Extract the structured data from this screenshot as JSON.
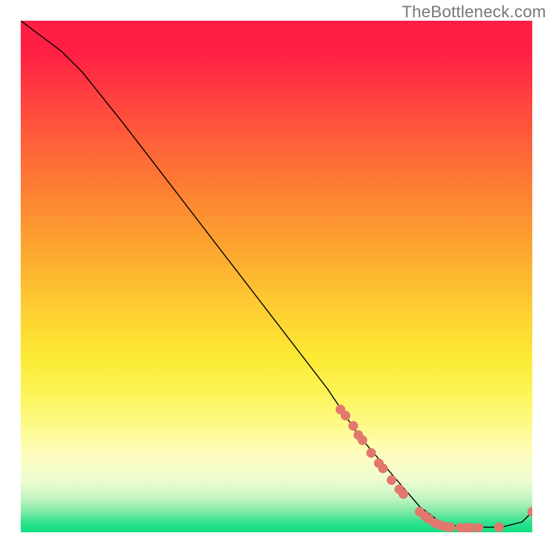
{
  "meta": {
    "watermark": "TheBottleneck.com"
  },
  "chart_data": {
    "type": "line",
    "title": "",
    "xlabel": "",
    "ylabel": "",
    "x_range": [
      0,
      100
    ],
    "y_range": [
      0,
      100
    ],
    "series": [
      {
        "name": "bottleneck-curve",
        "color": "#000000",
        "stroke_width": 1.5,
        "x": [
          0,
          4,
          8,
          12,
          20,
          30,
          40,
          50,
          60,
          66,
          72,
          78,
          82,
          86,
          90,
          94,
          98,
          100
        ],
        "y": [
          100,
          97,
          94,
          90,
          80,
          67,
          54,
          41,
          28,
          19,
          12,
          5,
          2,
          1,
          1,
          1,
          2,
          4
        ]
      }
    ],
    "scatter": {
      "name": "highlighted-points",
      "color": "#e2786d",
      "radius": 7,
      "points": [
        {
          "x": 62.5,
          "y": 24.0
        },
        {
          "x": 63.5,
          "y": 22.8
        },
        {
          "x": 65.0,
          "y": 20.8
        },
        {
          "x": 66.0,
          "y": 19.0
        },
        {
          "x": 66.8,
          "y": 18.0
        },
        {
          "x": 68.5,
          "y": 15.5
        },
        {
          "x": 70.0,
          "y": 13.5
        },
        {
          "x": 70.8,
          "y": 12.5
        },
        {
          "x": 72.5,
          "y": 10.2
        },
        {
          "x": 74.0,
          "y": 8.4
        },
        {
          "x": 74.8,
          "y": 7.5
        },
        {
          "x": 78.0,
          "y": 4.0
        },
        {
          "x": 79.0,
          "y": 3.2
        },
        {
          "x": 79.8,
          "y": 2.6
        },
        {
          "x": 81.0,
          "y": 1.8
        },
        {
          "x": 82.0,
          "y": 1.4
        },
        {
          "x": 83.0,
          "y": 1.1
        },
        {
          "x": 84.0,
          "y": 1.0
        },
        {
          "x": 86.0,
          "y": 0.9
        },
        {
          "x": 87.2,
          "y": 0.9
        },
        {
          "x": 88.0,
          "y": 0.9
        },
        {
          "x": 89.5,
          "y": 0.9
        },
        {
          "x": 93.5,
          "y": 1.0
        },
        {
          "x": 100.0,
          "y": 4.0
        }
      ]
    }
  }
}
